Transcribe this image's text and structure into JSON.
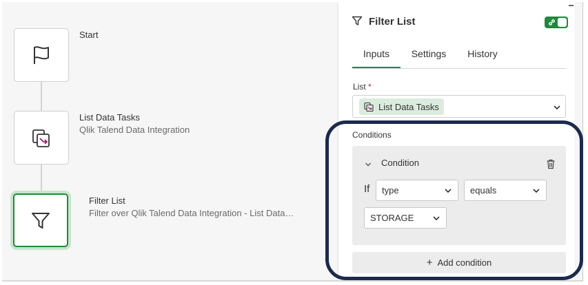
{
  "flow": {
    "nodes": [
      {
        "title": "Start",
        "subtitle": "",
        "icon": "flag-icon"
      },
      {
        "title": "List Data Tasks",
        "subtitle": "Qlik Talend Data Integration",
        "icon": "data-tasks-icon"
      },
      {
        "title": "Filter List",
        "subtitle": "Filter over Qlik Talend Data Integration - List Data…",
        "icon": "filter-icon"
      }
    ]
  },
  "panel": {
    "title": "Filter List",
    "tabs": [
      "Inputs",
      "Settings",
      "History"
    ],
    "active_tab": "Inputs",
    "list_label": "List",
    "required_mark": "*",
    "list_value": "List Data Tasks",
    "conditions_label": "Conditions",
    "condition": {
      "title": "Condition",
      "if_label": "If",
      "field": "type",
      "operator": "equals",
      "value": "STORAGE"
    },
    "add_condition": "Add condition",
    "add_symbol": "+"
  },
  "colors": {
    "accent_green": "#1f8a3a",
    "chip_bg": "#dbecde",
    "highlight_border": "#1b2a4e",
    "required_red": "#cc1f1f"
  }
}
